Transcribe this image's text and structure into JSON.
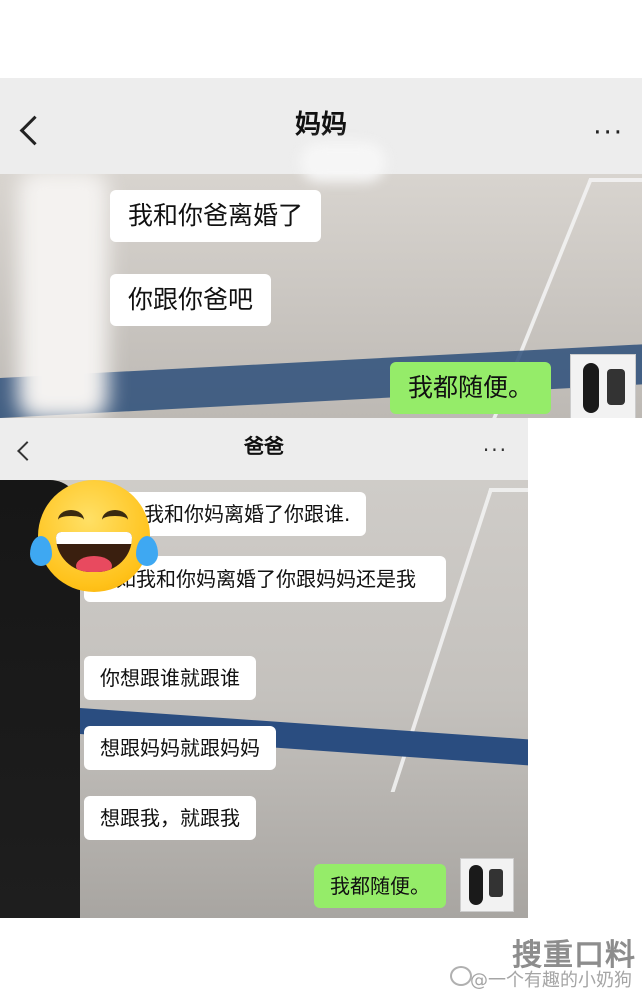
{
  "top_chat": {
    "title": "妈妈",
    "more": "···",
    "messages": [
      {
        "sender": "other",
        "text": "我和你爸离婚了"
      },
      {
        "sender": "other",
        "text": "你跟你爸吧"
      },
      {
        "sender": "self",
        "text": "我都随便。"
      }
    ]
  },
  "bottom_chat": {
    "title": "爸爸",
    "more": "···",
    "messages": [
      {
        "sender": "other",
        "text": "我和你妈离婚了你跟谁."
      },
      {
        "sender": "other",
        "text": "如我和你妈离婚了你跟妈妈还是我"
      },
      {
        "sender": "other",
        "text": "你想跟谁就跟谁"
      },
      {
        "sender": "other",
        "text": "想跟妈妈就跟妈妈"
      },
      {
        "sender": "other",
        "text": "想跟我，就跟我"
      },
      {
        "sender": "self",
        "text": "我都随便。"
      }
    ]
  },
  "watermark": {
    "logo": "搜重口料",
    "handle": "@一个有趣的小奶狗"
  },
  "colors": {
    "header_bg": "#ededed",
    "self_bubble": "#95ec69",
    "other_bubble": "#ffffff"
  },
  "icons": [
    "back-arrow-icon",
    "more-icon",
    "laughing-tears-emoji"
  ]
}
